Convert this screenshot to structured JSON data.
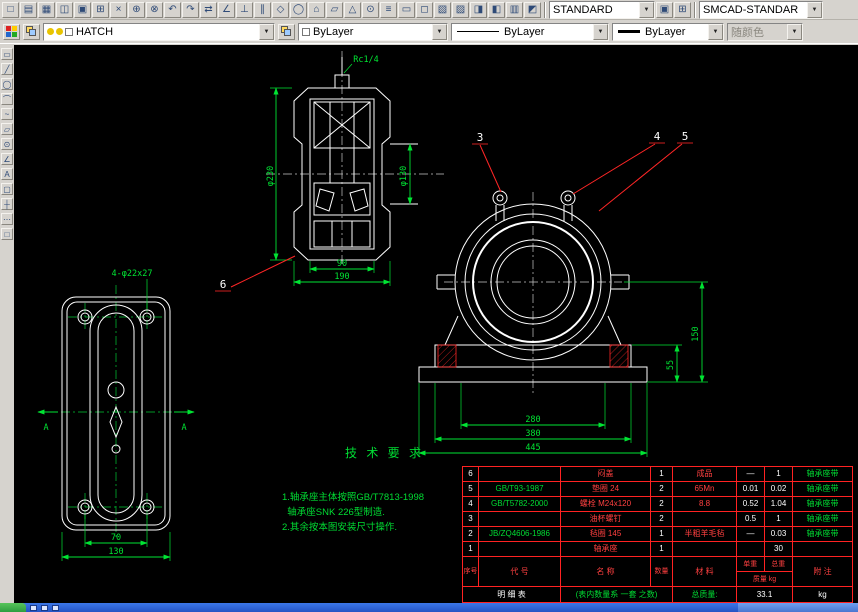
{
  "window": {
    "ui_bg": "#d6d3ce",
    "canvas_bg": "#000000"
  },
  "toolbar_top": {
    "icons": [
      "□",
      "▤",
      "▦",
      "◫",
      "▣",
      "⊞",
      "×",
      "⊕",
      "⊗",
      "↶",
      "↷",
      "⇄",
      "∠",
      "⊥",
      "∥",
      "◇",
      "◯",
      "⌂",
      "▱",
      "△",
      "⊙",
      "≡",
      "▭",
      "◻",
      "▧",
      "▨",
      "◨",
      "◧",
      "▥",
      "◩"
    ],
    "style_combo": {
      "value": "STANDARD"
    },
    "smcad_combo": {
      "value": "SMCAD-STANDAR"
    }
  },
  "toolbar_props": {
    "layer_combo": {
      "value": "HATCH"
    },
    "color_combo": {
      "value": "ByLayer"
    },
    "linetype_combo": {
      "value": "ByLayer"
    },
    "lineweight_combo": {
      "value": "ByLayer"
    },
    "plot_style_combo": {
      "value": "随颜色"
    }
  },
  "side_toolbar": {
    "icons": [
      "▭",
      "╱",
      "◯",
      "⌒",
      "~",
      "▱",
      "⊙",
      "∠",
      "A",
      "▢",
      "┼",
      "⋯",
      "□"
    ]
  },
  "drawing": {
    "colors": {
      "line": "#ffffff",
      "dimension": "#00e433",
      "leader": "#ff2626",
      "table_grid": "#ff2222"
    },
    "section_view": {
      "fitting_label": "Rc1/4",
      "dim_width_inner": "90",
      "dim_width_outer": "190",
      "dim_seat_diameter": "φ230",
      "dim_bore_diameter": "φ130",
      "balloon": "6"
    },
    "top_view": {
      "hole_label": "4-φ22x27",
      "section_letter": "A",
      "dim_hole_span": "70",
      "dim_base_width": "130"
    },
    "front_view": {
      "balloons": [
        "3",
        "4",
        "5"
      ],
      "dim_bolt_span": "280",
      "dim_base_span": "380",
      "dim_total_width": "445",
      "dim_center_height": "150",
      "dim_base_height": "55"
    },
    "tech_req": {
      "title": "技 术 要 求",
      "lines": [
        "1.轴承座主体按照GB/T7813-1998",
        "  轴承座SNK 226型制造.",
        "2.其余按本图安装尺寸操作."
      ]
    },
    "bom": {
      "headers": {
        "seq": "序号",
        "code": "代  号",
        "name": "名  称",
        "qty": "数量",
        "material": "材  料",
        "unit_weight": "单重",
        "total_weight": "总重",
        "mass_unit": "质量 kg",
        "note": "附 注"
      },
      "rows": [
        {
          "seq": "6",
          "code": "",
          "name": "闷盖",
          "qty": "1",
          "material": "成品",
          "unit": "—",
          "total": "1",
          "note": "轴承座带"
        },
        {
          "seq": "5",
          "code": "GB/T93-1987",
          "name": "垫圈 24",
          "qty": "2",
          "material": "65Mn",
          "unit": "0.01",
          "total": "0.02",
          "note": "轴承座带"
        },
        {
          "seq": "4",
          "code": "GB/T5782-2000",
          "name": "螺栓 M24x120",
          "qty": "2",
          "material": "8.8",
          "unit": "0.52",
          "total": "1.04",
          "note": "轴承座带"
        },
        {
          "seq": "3",
          "code": "",
          "name": "油杯螺钉",
          "qty": "2",
          "material": "",
          "unit": "0.5",
          "total": "1",
          "note": "轴承座带"
        },
        {
          "seq": "2",
          "code": "JB/ZQ4606-1986",
          "name": "毡圈 145",
          "qty": "1",
          "material": "半粗羊毛毡",
          "unit": "—",
          "total": "0.03",
          "note": "轴承座带"
        },
        {
          "seq": "1",
          "code": "",
          "name": "轴承座",
          "qty": "1",
          "material": "",
          "unit": "",
          "total": "30",
          "note": ""
        }
      ],
      "footer": {
        "title": "明 细 表",
        "note": "(表内数量系 一套 之数)",
        "total_label": "总质量:",
        "total_value": "33.1",
        "unit": "kg"
      }
    }
  }
}
